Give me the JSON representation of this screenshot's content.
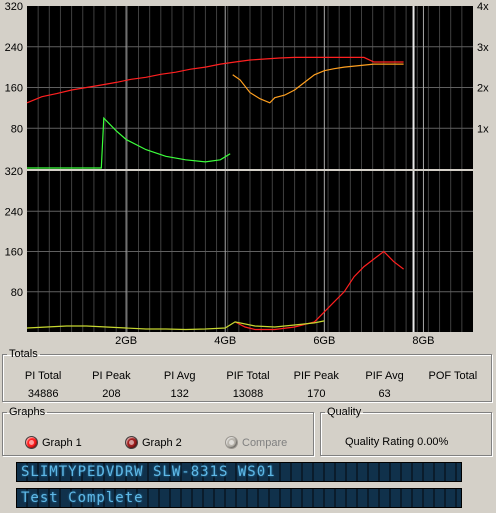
{
  "graphs": {
    "top": {
      "y_ticks_left": [
        "320",
        "240",
        "160",
        "80"
      ],
      "y_ticks_right": [
        "4x",
        "3x",
        "2x",
        "1x"
      ]
    },
    "bottom": {
      "y_ticks_left": [
        "320",
        "240",
        "160",
        "80"
      ]
    },
    "x_ticks": [
      "2GB",
      "4GB",
      "6GB",
      "8GB"
    ]
  },
  "chart_data": [
    {
      "type": "line",
      "panel": "top",
      "y_left_range": [
        0,
        320
      ],
      "y_right_range": [
        0,
        4
      ],
      "x_range_gb": [
        0,
        9
      ],
      "grid": true,
      "series": [
        {
          "color": "#ff2020",
          "x": [
            0.0,
            0.3,
            0.6,
            0.9,
            1.2,
            1.5,
            1.8,
            2.1,
            2.4,
            2.7,
            3.0,
            3.3,
            3.6,
            3.9,
            4.2,
            4.5,
            4.8,
            5.1,
            5.4,
            5.7,
            6.0,
            6.3,
            6.6,
            6.8,
            7.0,
            7.3,
            7.6
          ],
          "y": [
            130,
            142,
            148,
            155,
            160,
            165,
            170,
            176,
            180,
            186,
            190,
            196,
            200,
            206,
            210,
            214,
            216,
            218,
            219,
            219,
            219,
            219,
            219,
            219,
            210,
            210,
            210
          ]
        },
        {
          "color": "#ffa020",
          "x": [
            4.15,
            4.3,
            4.5,
            4.7,
            4.9,
            5.0,
            5.2,
            5.4,
            5.6,
            5.8,
            6.0,
            6.2,
            6.4,
            6.6,
            6.8,
            7.0,
            7.3,
            7.6
          ],
          "y": [
            185,
            175,
            150,
            138,
            130,
            140,
            145,
            155,
            170,
            185,
            193,
            197,
            200,
            202,
            204,
            206,
            206,
            206
          ]
        },
        {
          "color": "#3cff3c",
          "x": [
            0.0,
            0.5,
            1.0,
            1.5,
            1.55,
            1.8,
            2.0,
            2.4,
            2.8,
            3.2,
            3.6,
            3.9,
            4.1
          ],
          "y": [
            2,
            2,
            2,
            2,
            100,
            75,
            58,
            38,
            25,
            18,
            14,
            18,
            30
          ]
        }
      ]
    },
    {
      "type": "line",
      "panel": "bottom",
      "y_range": [
        0,
        320
      ],
      "x_range_gb": [
        0,
        9
      ],
      "grid": true,
      "series": [
        {
          "color": "#ff2020",
          "x": [
            4.2,
            4.4,
            4.6,
            5.0,
            5.4,
            5.8,
            6.0,
            6.2,
            6.4,
            6.6,
            6.8,
            7.0,
            7.2,
            7.4,
            7.6
          ],
          "y": [
            20,
            10,
            5,
            5,
            10,
            20,
            40,
            60,
            80,
            110,
            130,
            145,
            160,
            140,
            125
          ]
        },
        {
          "color": "#c8d830",
          "x": [
            0.0,
            0.4,
            0.8,
            1.2,
            1.6,
            2.0,
            2.4,
            2.8,
            3.2,
            3.6,
            4.0,
            4.2,
            4.6,
            5.0,
            5.4,
            5.8,
            6.0
          ],
          "y": [
            8,
            10,
            12,
            12,
            10,
            8,
            6,
            6,
            5,
            6,
            8,
            20,
            12,
            10,
            14,
            18,
            22
          ]
        }
      ]
    }
  ],
  "totals": {
    "legend": "Totals",
    "headers": [
      "PI Total",
      "PI Peak",
      "PI Avg",
      "PIF Total",
      "PIF Peak",
      "PIF Avg",
      "POF Total"
    ],
    "values": [
      "34886",
      "208",
      "132",
      "13088",
      "170",
      "63",
      ""
    ]
  },
  "graphs_group": {
    "legend": "Graphs",
    "graph1_label": "Graph 1",
    "graph1_color": "#ff2020",
    "graph2_label": "Graph 2",
    "graph2_color": "#a02020",
    "compare_label": "Compare"
  },
  "quality": {
    "legend": "Quality",
    "rating_text": "Quality Rating 0.00%"
  },
  "lcd": {
    "drive": "SLIMTYPEDVDRW SLW-831S WS01",
    "status": "Test Complete"
  }
}
